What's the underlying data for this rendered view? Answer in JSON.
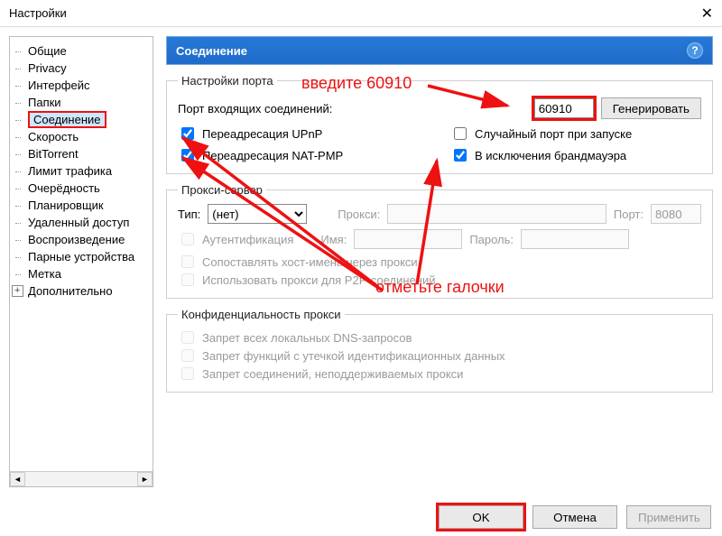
{
  "window": {
    "title": "Настройки",
    "close_glyph": "✕"
  },
  "tree": {
    "items": [
      "Общие",
      "Privacy",
      "Интерфейс",
      "Папки",
      "Соединение",
      "Скорость",
      "BitTorrent",
      "Лимит трафика",
      "Очерёдность",
      "Планировщик",
      "Удаленный доступ",
      "Воспроизведение",
      "Парные устройства",
      "Метка",
      "Дополнительно"
    ],
    "selected_index": 4,
    "expand_index": 14
  },
  "panel": {
    "title": "Соединение",
    "help_glyph": "?",
    "port_group": "Настройки порта",
    "incoming_label": "Порт входящих соединений:",
    "port_value": "60910",
    "generate_btn": "Генерировать",
    "upnp_label": "Переадресация UPnP",
    "natpmp_label": "Переадресация NAT-PMP",
    "random_label": "Случайный порт при запуске",
    "firewall_label": "В исключения брандмауэра",
    "proxy_group": "Прокси-сервер",
    "type_label": "Тип:",
    "type_value": "(нет)",
    "proxy_label": "Прокси:",
    "proxy_port_label": "Порт:",
    "proxy_port_value": "8080",
    "auth_label": "Аутентификация",
    "user_label": "Имя:",
    "pass_label": "Пароль:",
    "resolve_label": "Сопоставлять хост-имена через прокси",
    "p2p_label": "Использовать прокси для P2P-соединений",
    "priv_group": "Конфиденциальность прокси",
    "priv1": "Запрет всех локальных DNS-запросов",
    "priv2": "Запрет функций с утечкой идентификационных данных",
    "priv3": "Запрет соединений, неподдерживаемых прокси"
  },
  "annotations": {
    "enter": "введите 60910",
    "check": "отметьте галочки"
  },
  "footer": {
    "ok": "OK",
    "cancel": "Отмена",
    "apply": "Применить"
  }
}
